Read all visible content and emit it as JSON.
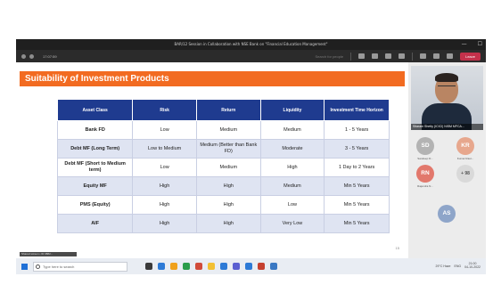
{
  "window": {
    "title": "BAR/12 Session in Collaboration with NSE Bank on \"Financial Education Management\"",
    "controls": [
      "—",
      "☐"
    ]
  },
  "toolbar": {
    "timer": "17:07:59",
    "search_placeholder": "Search for people",
    "leave_label": "Leave"
  },
  "slide": {
    "title": "Suitability of Investment Products",
    "page_number": "15",
    "footer_text": "Shared screen • ID 3882...",
    "columns": [
      "Asset Class",
      "Risk",
      "Return",
      "Liquidity",
      "Investment Time Horizon"
    ],
    "rows": [
      {
        "asset": "Bank FD",
        "risk": "Low",
        "return": "Medium",
        "liquidity": "Medium",
        "horizon": "1 - 5 Years"
      },
      {
        "asset": "Debt MF (Long Term)",
        "risk": "Low to Medium",
        "return": "Medium (Better than Bank FD)",
        "liquidity": "Moderate",
        "horizon": "3 - 5 Years"
      },
      {
        "asset": "Debt MF (Short to Medium term)",
        "risk": "Low",
        "return": "Medium",
        "liquidity": "High",
        "horizon": "1 Day to 2 Years"
      },
      {
        "asset": "Equity MF",
        "risk": "High",
        "return": "High",
        "liquidity": "Medium",
        "horizon": "Min 5 Years"
      },
      {
        "asset": "PMS (Equity)",
        "risk": "High",
        "return": "High",
        "liquidity": "Low",
        "horizon": "Min 5 Years"
      },
      {
        "asset": "AIF",
        "risk": "High",
        "return": "High",
        "liquidity": "Very Low",
        "horizon": "Min 5 Years"
      }
    ]
  },
  "participants": {
    "presenter_caption": "Sitaram Shetty (ICICI) NISM MFCA...",
    "list": [
      {
        "initials": "SD",
        "name": "Sandeep D...",
        "color": "#b3b3b3"
      },
      {
        "initials": "KR",
        "name": "Kumar Raut...",
        "color": "#e7a78d"
      },
      {
        "initials": "RN",
        "name": "Rajendra N...",
        "color": "#e2786c"
      },
      {
        "initials": "AS",
        "name": "",
        "color": "#8ea5c9"
      }
    ],
    "more_label": "+ 98"
  },
  "taskbar": {
    "search_placeholder": "Type here to search",
    "apps": [
      "#3a3a3a",
      "#2d7ad6",
      "#f0a11b",
      "#2a9d4b",
      "#d14b3a",
      "#f2c033",
      "#2d7ad6",
      "#5a5fd1",
      "#2d7ad6",
      "#c5402f",
      "#3a78c3"
    ],
    "weather": "29°C Haze",
    "lang": "ENG",
    "time": "21:00",
    "date": "04-10-2022"
  }
}
